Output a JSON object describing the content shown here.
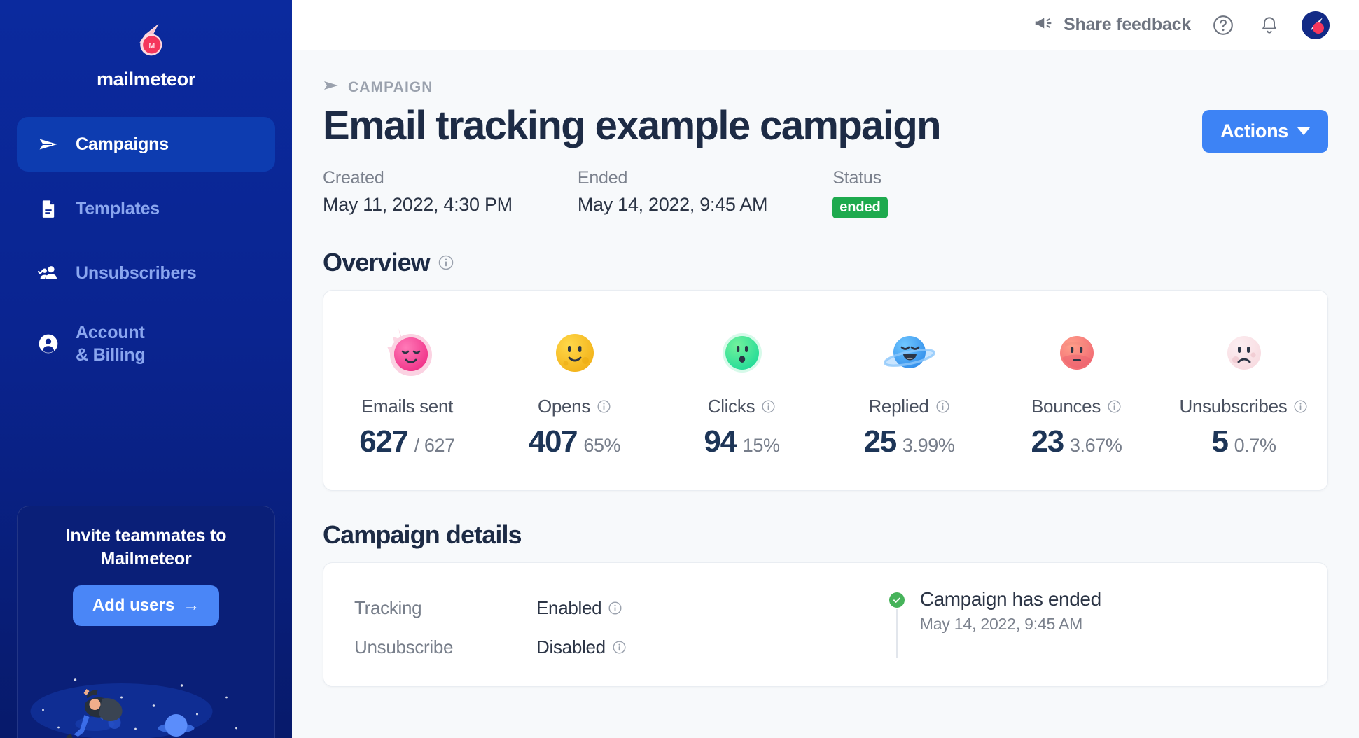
{
  "sidebar": {
    "brand": {
      "name": "mailmeteor",
      "logo_icon": "meteor-logo-icon"
    },
    "items": [
      {
        "label": "Campaigns",
        "icon": "paper-plane-icon",
        "active": true
      },
      {
        "label": "Templates",
        "icon": "document-icon",
        "active": false
      },
      {
        "label": "Unsubscribers",
        "icon": "users-check-icon",
        "active": false
      },
      {
        "label_line1": "Account",
        "label_line2": "& Billing",
        "icon": "person-circle-icon",
        "active": false
      }
    ],
    "invite": {
      "title": "Invite teammates to Mailmeteor",
      "button_label": "Add users",
      "button_arrow": "→"
    }
  },
  "topbar": {
    "feedback_label": "Share feedback",
    "feedback_icon": "megaphone-icon",
    "help_icon": "help-circle-icon",
    "bell_icon": "bell-icon",
    "avatar_icon": "user-avatar-meteor-icon"
  },
  "header": {
    "breadcrumb_icon": "paper-plane-icon",
    "breadcrumb": "CAMPAIGN",
    "title": "Email tracking example campaign",
    "actions_label": "Actions"
  },
  "meta": [
    {
      "label": "Created",
      "value": "May 11, 2022, 4:30 PM"
    },
    {
      "label": "Ended",
      "value": "May 14, 2022, 9:45 AM"
    }
  ],
  "status": {
    "label": "Status",
    "badge": "ended",
    "badge_color": "#1eaa4e"
  },
  "overview": {
    "heading": "Overview",
    "info_icon": "info-icon",
    "stats": [
      {
        "emoji": "pink-meteor-face",
        "label": "Emails sent",
        "has_info": false,
        "main": "627",
        "sub": "/ 627"
      },
      {
        "emoji": "yellow-moon-face",
        "label": "Opens",
        "has_info": true,
        "main": "407",
        "sub": "65%"
      },
      {
        "emoji": "green-planet-face",
        "label": "Clicks",
        "has_info": true,
        "main": "94",
        "sub": "15%"
      },
      {
        "emoji": "blue-ringed-planet-face",
        "label": "Replied",
        "has_info": true,
        "main": "25",
        "sub": "3.99%"
      },
      {
        "emoji": "red-planet-face",
        "label": "Bounces",
        "has_info": true,
        "main": "23",
        "sub": "3.67%"
      },
      {
        "emoji": "pale-pink-sad-moon",
        "label": "Unsubscribes",
        "has_info": true,
        "main": "5",
        "sub": "0.7%"
      }
    ]
  },
  "details": {
    "heading": "Campaign details",
    "rows": [
      {
        "key": "Tracking",
        "value": "Enabled",
        "has_info": true
      },
      {
        "key": "Unsubscribe",
        "value": "Disabled",
        "has_info": true
      }
    ],
    "timeline": [
      {
        "title": "Campaign has ended",
        "date": "May 14, 2022, 9:45 AM",
        "state_icon": "check-circle-icon"
      }
    ]
  },
  "colors": {
    "accent_blue": "#3d83f5",
    "sidebar_blue": "#0a2490",
    "title_navy": "#1d2b45",
    "green": "#1eaa4e"
  }
}
